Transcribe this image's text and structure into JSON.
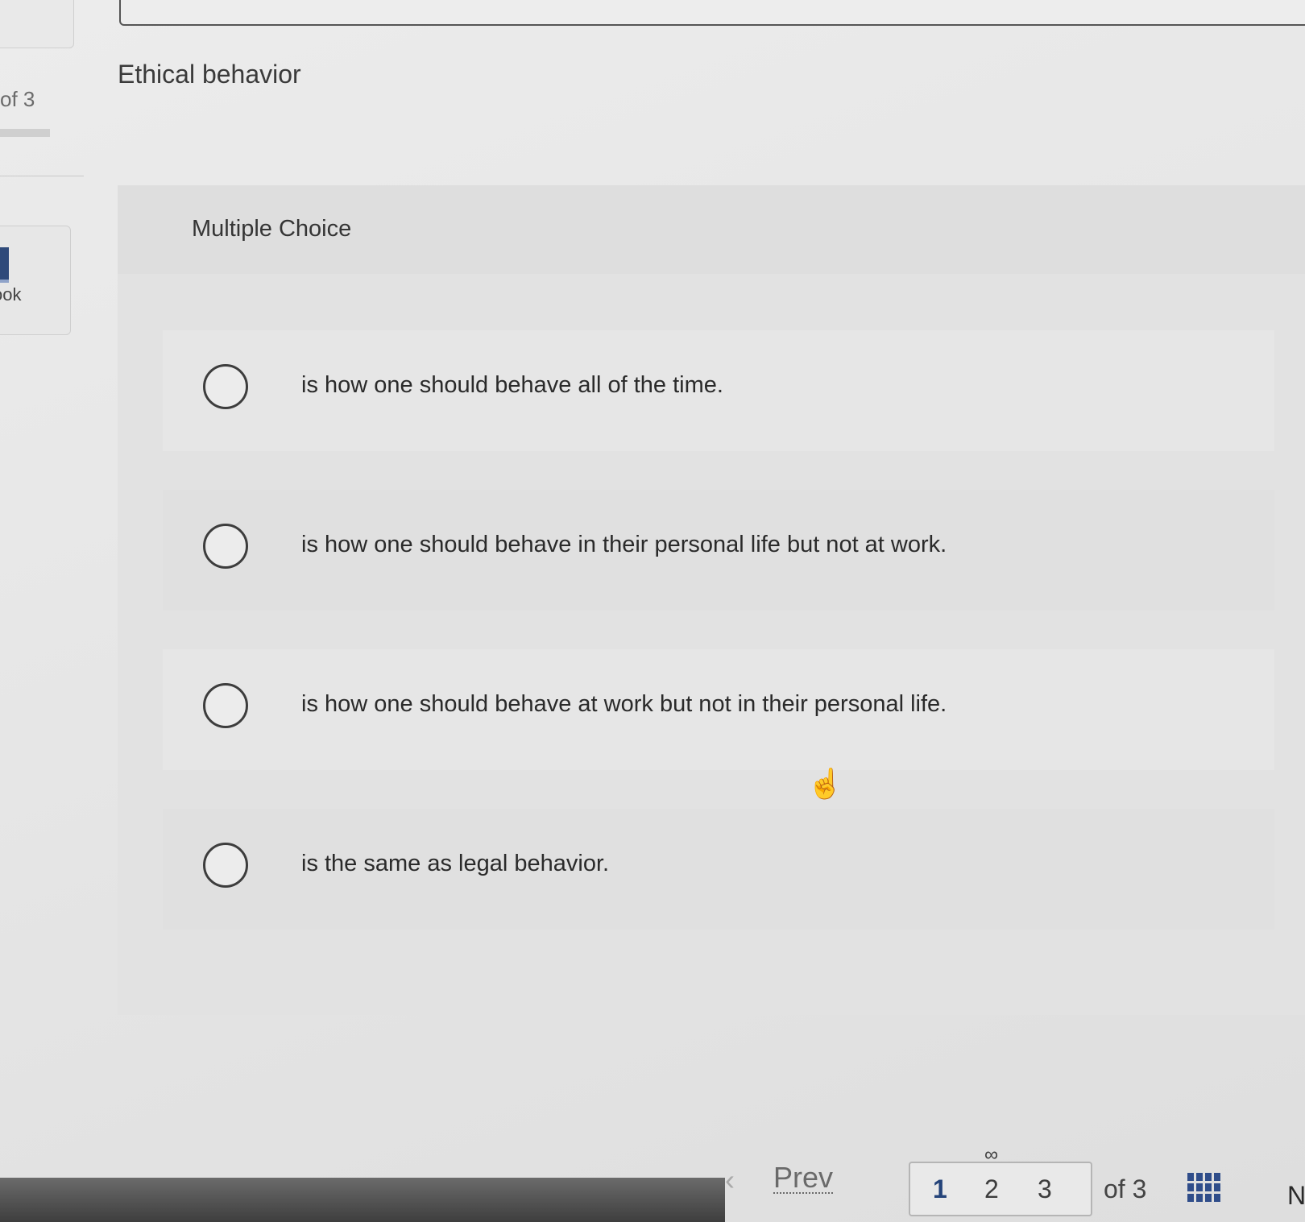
{
  "sidebar": {
    "counter_text": "of 3",
    "ebook_label": "ook"
  },
  "question": {
    "title": "Ethical behavior",
    "type_label": "Multiple Choice",
    "options": [
      {
        "text": "is how one should behave all of the time."
      },
      {
        "text": "is how one should behave in their personal life but not at work."
      },
      {
        "text": "is how one should behave at work but not in their personal life."
      },
      {
        "text": "is the same as legal behavior."
      }
    ]
  },
  "navigation": {
    "prev_label": "Prev",
    "pages": [
      "1",
      "2",
      "3"
    ],
    "current_page": "1",
    "of_total": "of 3",
    "next_label": "N"
  },
  "icons": {
    "prev": "chevron-left-icon",
    "link": "link-icon",
    "grid": "grid-icon",
    "cursor": "hand-cursor-icon"
  },
  "colors": {
    "accent": "#25447a",
    "grid_icon": "#2f4d8a"
  }
}
